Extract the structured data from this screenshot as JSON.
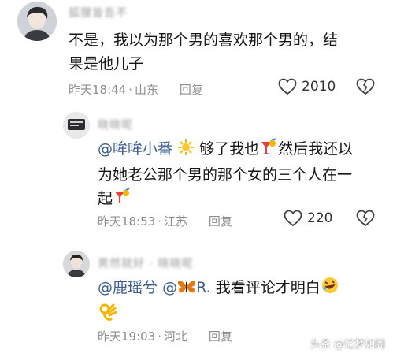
{
  "comments": [
    {
      "username": "狐狸皆吾不",
      "text": "不是，我以为那个男的喜欢那个男的，结果是他儿子",
      "line1": "不是，我以为那个男的喜欢那个男的，结",
      "line2": "果是他儿子",
      "time": "昨天18:44",
      "location": "山东",
      "reply_label": "回复",
      "likes": "2010"
    },
    {
      "username": "晓晓呢",
      "mention": "@哞哞小番",
      "line1_rest": "够了我也",
      "line1_tail": "然后我还以",
      "line2": "为她老公那个男的那个女的三个人在一",
      "line3": "起",
      "time": "昨天18:53",
      "location": "江苏",
      "reply_label": "回复",
      "likes": "220"
    },
    {
      "username": "男然就好 · 晓晓呢",
      "mention1": "@鹿瑶兮",
      "mention2": "@",
      "mention2_rest": "R.",
      "text_rest": "我看评论才明白",
      "time": "昨天19:03",
      "location": "河北",
      "reply_label": "回复"
    }
  ],
  "watermark": {
    "prefix": "头条",
    "handle": "@忆梦如阁"
  },
  "icons": {
    "like": "heart-outline-icon",
    "dislike": "broken-heart-icon",
    "emoji_sun": "sun-emoji-icon",
    "emoji_drink": "tropical-drink-emoji-icon",
    "emoji_butterfly": "butterfly-emoji-icon",
    "emoji_laugh": "rolling-laugh-emoji-icon",
    "emoji_ok": "ok-hand-emoji-icon"
  }
}
